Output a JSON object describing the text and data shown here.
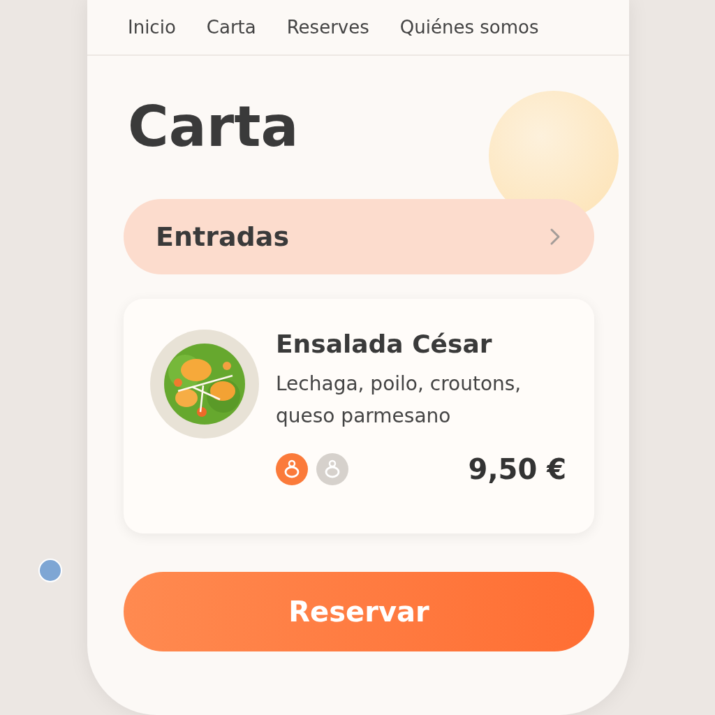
{
  "nav": {
    "items": [
      {
        "label": "Inicio"
      },
      {
        "label": "Carta"
      },
      {
        "label": "Reserves"
      },
      {
        "label": "Quiénes somos"
      }
    ]
  },
  "page_title": "Carta",
  "category": {
    "label": "Entradas",
    "expanded": false
  },
  "dish": {
    "kind": "picture",
    "name": "Ensalada César",
    "description": "Lechaga, poilo, croutons, queso parmesano",
    "price": "9,50 €",
    "badges": [
      {
        "on": true
      },
      {
        "on": false
      }
    ]
  },
  "reserve_button": "Reservar"
}
